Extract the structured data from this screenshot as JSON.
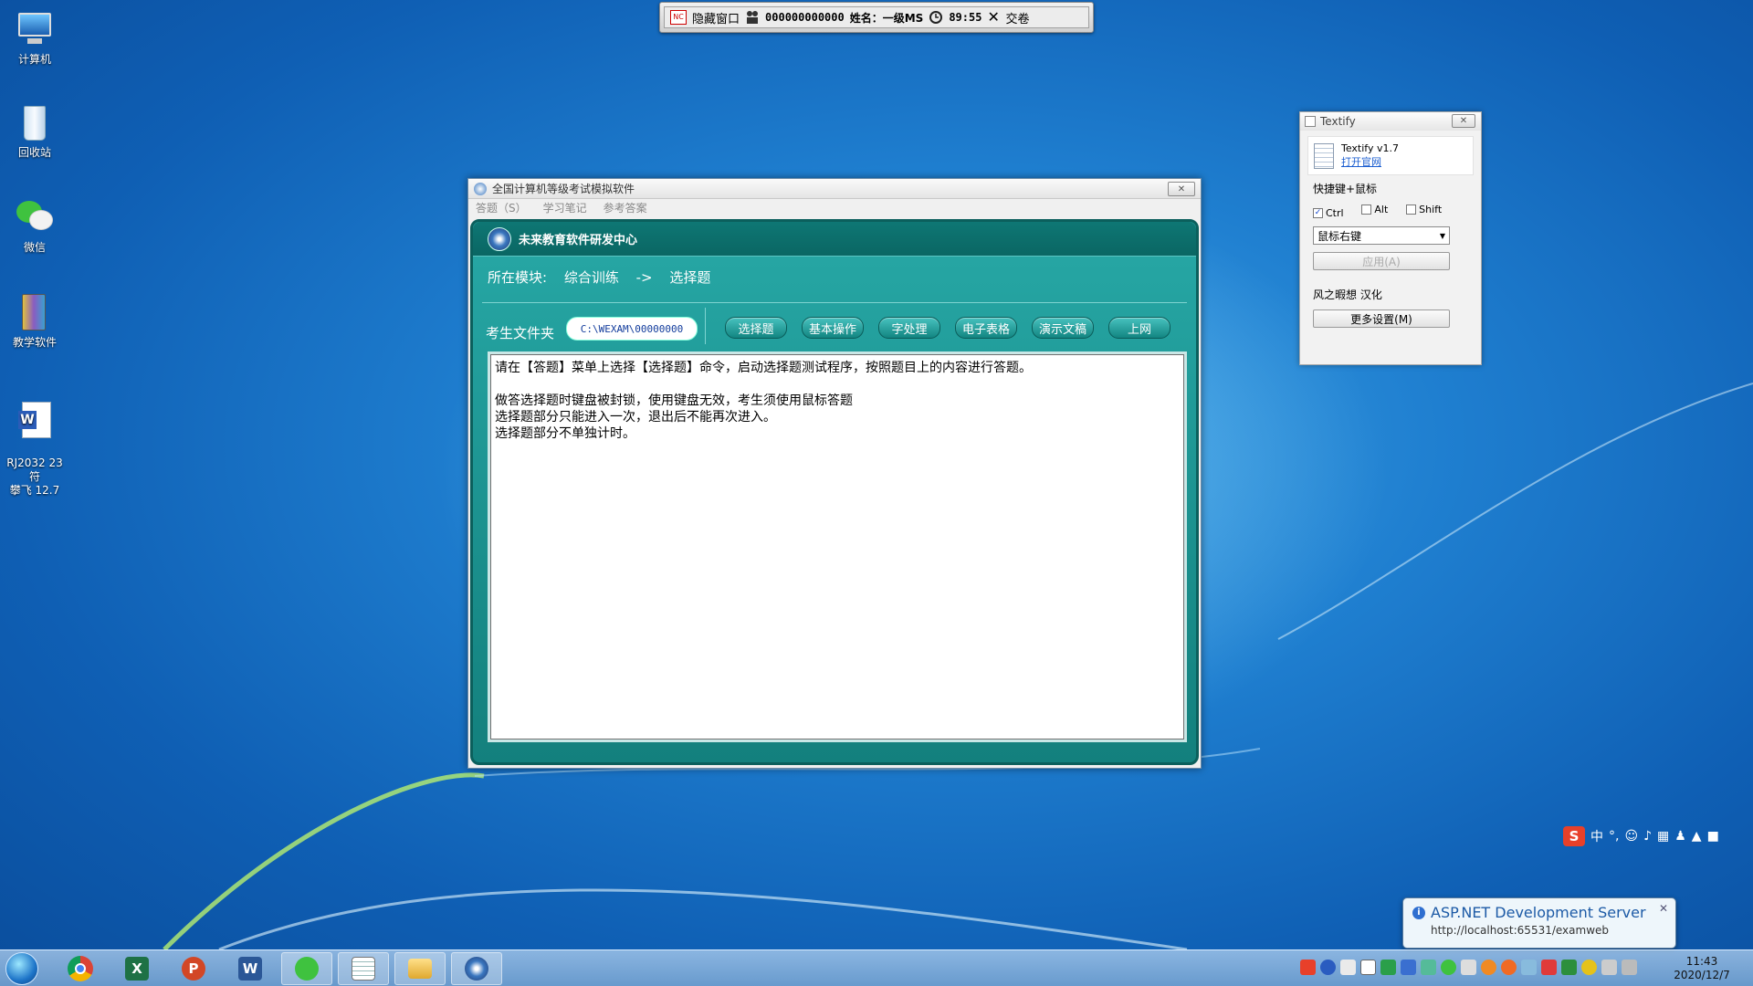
{
  "desktop": {
    "icons": [
      {
        "label": "计算机"
      },
      {
        "label": "回收站"
      },
      {
        "label": "微信"
      },
      {
        "label": "教学软件"
      },
      {
        "label": "RJ2032 23符\n攀飞 12.7"
      }
    ]
  },
  "exam_bar": {
    "hide_window": "隐藏窗口",
    "candidate_id": "000000000000",
    "name": "姓名：一级MS",
    "timer": "89:55",
    "submit": "交卷"
  },
  "exam_window": {
    "title": "全国计算机等级考试模拟软件",
    "menu": [
      "答题（S）",
      "学习笔记",
      "参考答案"
    ],
    "header": "未来教育软件研发中心",
    "module_label": "所在模块:",
    "module_path": "综合训练",
    "module_arrow": "->",
    "module_current": "选择题",
    "folder_label": "考生文件夹",
    "folder_path": "C:\\WEXAM\\00000000",
    "tabs": [
      "选择题",
      "基本操作",
      "字处理",
      "电子表格",
      "演示文稿",
      "上网"
    ],
    "content_lines": [
      "请在【答题】菜单上选择【选择题】命令，启动选择题测试程序，按照题目上的内容进行答题。",
      "",
      "做答选择题时键盘被封锁，使用键盘无效，考生须使用鼠标答题",
      "选择题部分只能进入一次，退出后不能再次进入。",
      "选择题部分不单独计时。"
    ]
  },
  "textify": {
    "title": "Textify",
    "version": "Textify v1.7",
    "link": "打开官网",
    "hotkey_label": "快捷键+鼠标",
    "ctrl": "Ctrl",
    "alt": "Alt",
    "shift": "Shift",
    "mouse_select": "鼠标右键",
    "apply": "应用(A)",
    "credit": "风之暇想 汉化",
    "more": "更多设置(M)"
  },
  "balloon": {
    "title": "ASP.NET Development Server",
    "url": "http://localhost:65531/examweb"
  },
  "ime": {
    "mode": "中"
  },
  "clock": {
    "time": "11:43",
    "date": "2020/12/7"
  },
  "colors": {
    "panel": "#17908d",
    "header": "#0b6b68",
    "desktop": "#1f7fd0"
  }
}
